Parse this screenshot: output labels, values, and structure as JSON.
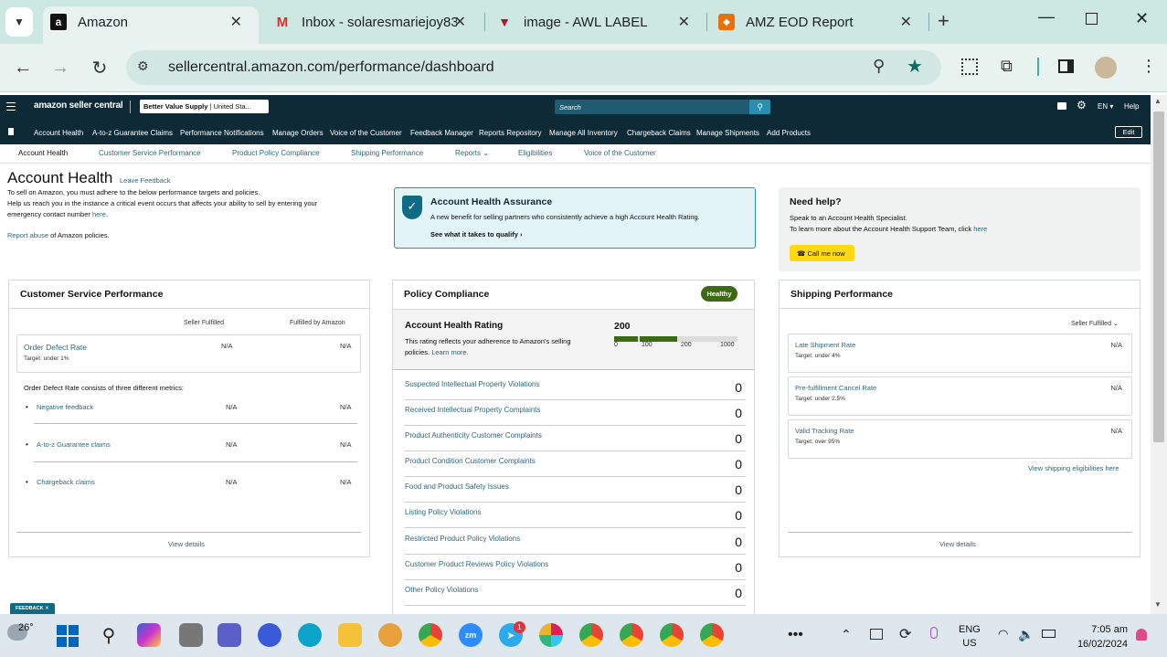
{
  "browser": {
    "tabs": [
      {
        "title": "Amazon",
        "icon": "amazon-icon"
      },
      {
        "title": "Inbox - solaresmariejoy83",
        "icon": "gmail-icon"
      },
      {
        "title": "image - AWL LABEL",
        "icon": "awl-icon"
      },
      {
        "title": "AMZ EOD Report",
        "icon": "sheets-icon"
      }
    ],
    "url": "sellercentral.amazon.com/performance/dashboard"
  },
  "seller_central": {
    "logo": "amazon seller central",
    "store": "Better Value Supply",
    "store_region": "| United Sta...",
    "search_placeholder": "Search",
    "lang": "EN",
    "help": "Help",
    "nav": [
      "Account Health",
      "A-to-z Guarantee Claims",
      "Performance Notifications",
      "Manage Orders",
      "Voice of the Customer",
      "Feedback Manager",
      "Reports Repository",
      "Manage All Inventory",
      "Chargeback Claims",
      "Manage Shipments",
      "Add Products"
    ],
    "edit": "Edit",
    "subnav": [
      "Account Health",
      "Customer Service Performance",
      "Product Policy Compliance",
      "Shipping Performance",
      "Reports",
      "Eligibilities",
      "Voice of the Customer"
    ]
  },
  "page": {
    "title": "Account Health",
    "leave_feedback": "Leave Feedback",
    "intro1": "To sell on Amazon, you must adhere to the below performance targets and policies.",
    "intro2": "Help us reach you in the instance a critical event occurs that affects your ability to sell by entering your",
    "intro3_pre": "emergency contact number ",
    "intro3_link": "here",
    "intro3_post": ".",
    "report_link": "Report abuse",
    "report_post": " of Amazon policies."
  },
  "assurance": {
    "title": "Account Health Assurance",
    "desc": "A new benefit for selling partners who consistently achieve a high Account Health Rating.",
    "cta": "See what it takes to qualify"
  },
  "help": {
    "title": "Need help?",
    "line1": "Speak to an Account Health Specialist.",
    "line2_pre": "To learn more about the Account Health Support Team, click ",
    "line2_link": "here",
    "call": "Call me now"
  },
  "csp": {
    "title": "Customer Service Performance",
    "col1": "Seller Fulfilled",
    "col2": "Fulfilled by Amazon",
    "odr_label": "Order Defect Rate",
    "odr_target": "Target: under 1%",
    "odr_v1": "N/A",
    "odr_v2": "N/A",
    "consists": "Order Defect Rate consists of three different metrics:",
    "metrics": [
      {
        "label": "Negative feedback",
        "v1": "N/A",
        "v2": "N/A"
      },
      {
        "label": "A-to-z Guarantee claims",
        "v1": "N/A",
        "v2": "N/A"
      },
      {
        "label": "Chargeback claims",
        "v1": "N/A",
        "v2": "N/A"
      }
    ],
    "view": "View details"
  },
  "policy": {
    "title": "Policy Compliance",
    "badge": "Healthy",
    "ahr_title": "Account Health Rating",
    "ahr_desc1": "This rating reflects your adherence to Amazon's selling",
    "ahr_desc2_pre": "policies. ",
    "ahr_desc2_link": "Learn more.",
    "ahr_value": "200",
    "scale": [
      "0",
      "100",
      "200",
      "1000"
    ],
    "rows": [
      {
        "label": "Suspected Intellectual Property Violations",
        "count": "0"
      },
      {
        "label": "Received Intellectual Property Complaints",
        "count": "0"
      },
      {
        "label": "Product Authenticity Customer Complaints",
        "count": "0"
      },
      {
        "label": "Product Condition Customer Complaints",
        "count": "0"
      },
      {
        "label": "Food and Product Safety Issues",
        "count": "0"
      },
      {
        "label": "Listing Policy Violations",
        "count": "0"
      },
      {
        "label": "Restricted Product Policy Violations",
        "count": "0"
      },
      {
        "label": "Customer Product Reviews Policy Violations",
        "count": "0"
      },
      {
        "label": "Other Policy Violations",
        "count": "0"
      }
    ]
  },
  "shipping": {
    "title": "Shipping Performance",
    "filter": "Seller Fulfilled",
    "metrics": [
      {
        "label": "Late Shipment Rate",
        "target": "Target: under 4%",
        "value": "N/A"
      },
      {
        "label": "Pre-fulfillment Cancel Rate",
        "target": "Target: under 2.5%",
        "value": "N/A"
      },
      {
        "label": "Valid Tracking Rate",
        "target": "Target: over 95%",
        "value": "N/A"
      }
    ],
    "elig": "View shipping eligibilities here",
    "view": "View details"
  },
  "feedback_tab": "FEEDBACK",
  "taskbar": {
    "temp": "26°",
    "lang1": "ENG",
    "lang2": "US",
    "time": "7:05 am",
    "date": "16/02/2024",
    "badge": "1"
  },
  "colors": {
    "navy": "#0e2a37",
    "link": "#2e6678",
    "healthy": "#3d6b14",
    "accent": "#febd69"
  }
}
